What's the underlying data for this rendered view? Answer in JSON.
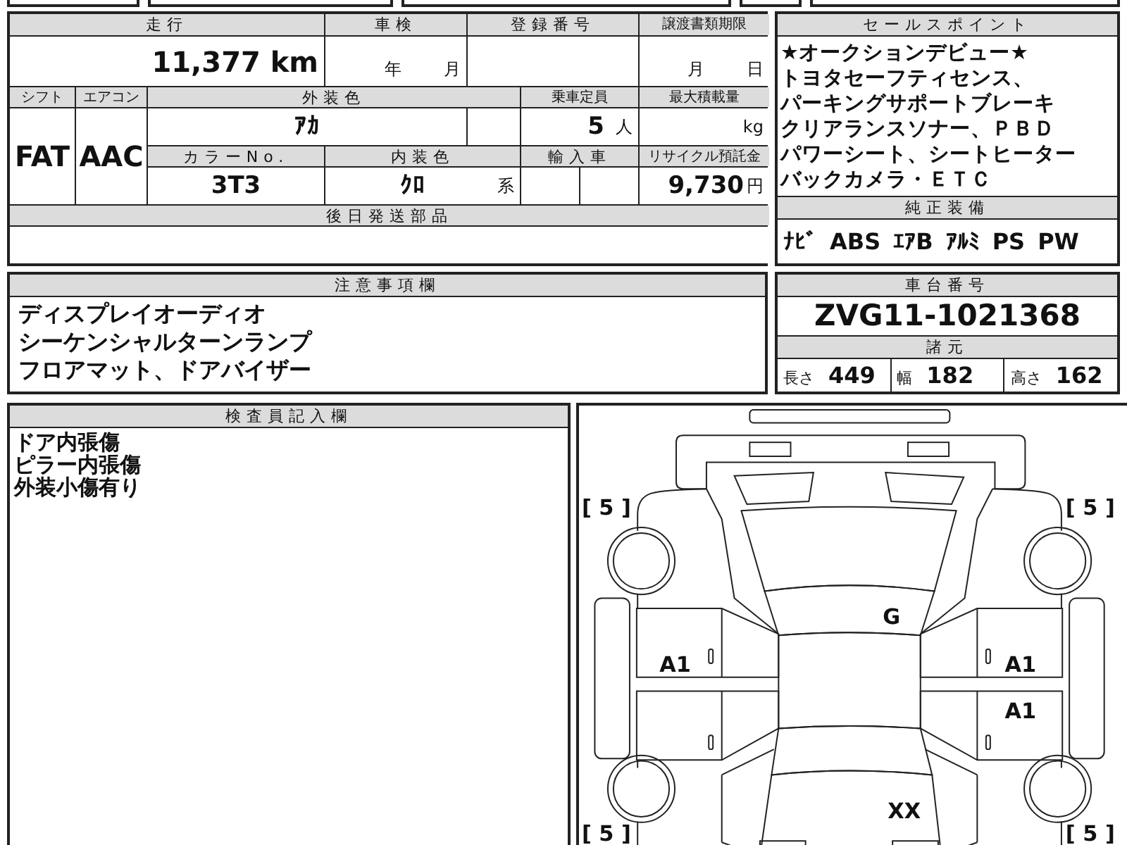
{
  "vehicle_info": {
    "mileage": {
      "label": "走行",
      "value": "11,377",
      "unit": "km"
    },
    "inspection": {
      "label": "車検",
      "year_unit": "年",
      "month_unit": "月"
    },
    "registration": {
      "label": "登録番号"
    },
    "transfer_deadline": {
      "label": "譲渡書類期限",
      "month_unit": "月",
      "day_unit": "日"
    },
    "shift": {
      "label": "シフト",
      "value": "FAT"
    },
    "air_conditioner": {
      "label": "エアコン",
      "value": "AAC"
    },
    "exterior_color": {
      "label": "外装色",
      "value": "ｱｶ"
    },
    "capacity": {
      "label": "乗車定員",
      "value": "5",
      "unit": "人"
    },
    "max_load": {
      "label": "最大積載量",
      "unit": "kg"
    },
    "color_code": {
      "label": "カラーNo.",
      "value": "3T3"
    },
    "interior_color": {
      "label": "内装色",
      "value": "ｸﾛ",
      "suffix": "系"
    },
    "imported": {
      "label": "輸入車"
    },
    "recycling_fee": {
      "label": "リサイクル預託金",
      "value": "9,730",
      "unit": "円"
    },
    "later_parts": {
      "label": "後日発送部品"
    }
  },
  "sale_points": {
    "title": "セールスポイント",
    "lines": [
      "★オークションデビュー★",
      "トヨタセーフティセンス、",
      "パーキングサポートブレーキ",
      "クリアランスソナー、ＰＢＤ",
      "パワーシート、シートヒーター",
      "バックカメラ・ＥＴＣ"
    ]
  },
  "equipment": {
    "title": "純正装備",
    "items": [
      "ﾅﾋﾞ",
      "ABS",
      "ｴｱB",
      "ｱﾙﾐ",
      "PS",
      "PW"
    ]
  },
  "notes": {
    "title": "注意事項欄",
    "lines": [
      "ディスプレイオーディオ",
      "シーケンシャルターンランプ",
      "フロアマット、ドアバイザー"
    ]
  },
  "chassis": {
    "title": "車台番号",
    "number": "ZVG11-1021368",
    "specs_title": "諸元",
    "specs": [
      {
        "label": "長さ",
        "value": "449"
      },
      {
        "label": "幅",
        "value": "182"
      },
      {
        "label": "高さ",
        "value": "162"
      }
    ]
  },
  "inspector": {
    "title": "検査員記入欄",
    "lines": [
      "ドア内張傷",
      "ピラー内張傷",
      "外装小傷有り"
    ]
  },
  "diagram": {
    "tire_ratings": [
      "[ 5 ]",
      "[ 5 ]",
      "[ 5 ]",
      "[ 5 ]"
    ],
    "damage_codes": [
      "G",
      "A1",
      "A1",
      "A1",
      "XX"
    ]
  }
}
